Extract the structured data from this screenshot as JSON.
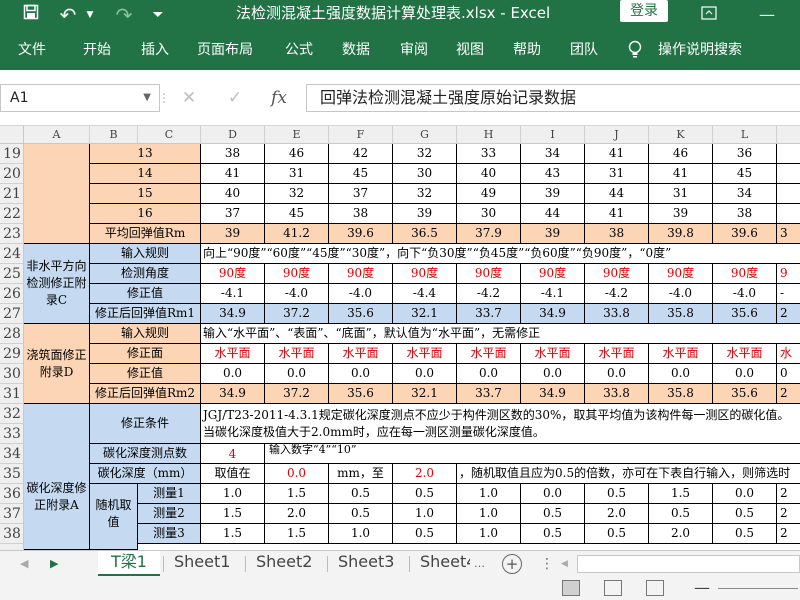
{
  "window": {
    "title": "法检测混凝土强度数据计算处理表.xlsx - Excel",
    "login_label": "登录"
  },
  "ribbon": {
    "tabs": [
      "文件",
      "开始",
      "插入",
      "页面布局",
      "公式",
      "数据",
      "审阅",
      "视图",
      "帮助",
      "团队"
    ],
    "tell_me": "操作说明搜索"
  },
  "formula_bar": {
    "cell_ref": "A1",
    "content": "回弹法检测混凝土强度原始记录数据"
  },
  "columns": [
    "A",
    "B",
    "C",
    "D",
    "E",
    "F",
    "G",
    "H",
    "I",
    "J",
    "K",
    "L"
  ],
  "rows": [
    "19",
    "20",
    "21",
    "22",
    "23",
    "24",
    "25",
    "26",
    "27",
    "28",
    "29",
    "30",
    "31",
    "32",
    "33",
    "34",
    "35",
    "36",
    "37",
    "38"
  ],
  "sheet": {
    "r19": {
      "label": "13",
      "values": [
        "38",
        "46",
        "42",
        "32",
        "33",
        "34",
        "41",
        "46",
        "36"
      ]
    },
    "r20": {
      "label": "14",
      "values": [
        "41",
        "31",
        "45",
        "30",
        "40",
        "43",
        "31",
        "41",
        "45"
      ]
    },
    "r21": {
      "label": "15",
      "values": [
        "40",
        "32",
        "37",
        "32",
        "49",
        "39",
        "44",
        "31",
        "34"
      ]
    },
    "r22": {
      "label": "16",
      "values": [
        "37",
        "45",
        "38",
        "39",
        "30",
        "44",
        "41",
        "39",
        "38"
      ]
    },
    "r23": {
      "label": "平均回弹值Rm",
      "values": [
        "39",
        "41.2",
        "39.6",
        "36.5",
        "37.9",
        "39",
        "38",
        "39.8",
        "39.6"
      ],
      "overflow": "3"
    },
    "group_c": {
      "label": "非水平方向检测修正附录C"
    },
    "r24": {
      "label": "输入规则",
      "text": "向上“90度”“60度”“45度”“30度”，向下“负30度”“负45度”“负60度”“负90度”，“0度”"
    },
    "r25": {
      "label": "检测角度",
      "values": [
        "90度",
        "90度",
        "90度",
        "90度",
        "90度",
        "90度",
        "90度",
        "90度",
        "90度"
      ],
      "overflow": "9"
    },
    "r26": {
      "label": "修正值",
      "values": [
        "-4.1",
        "-4.0",
        "-4.0",
        "-4.4",
        "-4.2",
        "-4.1",
        "-4.2",
        "-4.0",
        "-4.0"
      ],
      "overflow": "-"
    },
    "r27": {
      "label": "修正后回弹值Rm1",
      "values": [
        "34.9",
        "37.2",
        "35.6",
        "32.1",
        "33.7",
        "34.9",
        "33.8",
        "35.8",
        "35.6"
      ],
      "overflow": "2"
    },
    "group_d": {
      "label": "浇筑面修正附录D"
    },
    "r28": {
      "label": "输入规则",
      "text": "输入“水平面”、“表面”、“底面”，默认值为“水平面”，无需修正"
    },
    "r29": {
      "label": "修正面",
      "values": [
        "水平面",
        "水平面",
        "水平面",
        "水平面",
        "水平面",
        "水平面",
        "水平面",
        "水平面",
        "水平面"
      ],
      "overflow": "水"
    },
    "r30": {
      "label": "修正值",
      "values": [
        "0.0",
        "0.0",
        "0.0",
        "0.0",
        "0.0",
        "0.0",
        "0.0",
        "0.0",
        "0.0"
      ],
      "overflow": "0"
    },
    "r31": {
      "label": "修正后回弹值Rm2",
      "values": [
        "34.9",
        "37.2",
        "35.6",
        "32.1",
        "33.7",
        "34.9",
        "33.8",
        "35.8",
        "35.6"
      ],
      "overflow": "2"
    },
    "group_a": {
      "label": "碳化深度修正附录A"
    },
    "r32": {
      "label": "修正条件",
      "text": "JGJ/T23-2011-4.3.1规定碳化深度测点不应少于构件测区数的30%，取其平均值为该构件每一测区的碳化值。当碳化深度极值大于2.0mm时，应在每一测区测量碳化深度值。"
    },
    "r34": {
      "label": "碳化深度测点数",
      "value": "4",
      "note": "输入数字“4”“10”"
    },
    "r35": {
      "label": "碳化深度（mm）",
      "take": "取值在",
      "min": "0.0",
      "mm_to": "mm，至",
      "max": "2.0",
      "note": "，随机取值且应为0.5的倍数，亦可在下表自行输入，则筛选时"
    },
    "random_label": "随机取值",
    "r36": {
      "label": "测量1",
      "values": [
        "1.0",
        "1.5",
        "0.5",
        "0.5",
        "1.0",
        "0.0",
        "0.5",
        "1.5",
        "0.0"
      ],
      "overflow": "2"
    },
    "r37": {
      "label": "测量2",
      "values": [
        "1.5",
        "2.0",
        "0.5",
        "1.0",
        "1.0",
        "0.5",
        "2.0",
        "0.5",
        "0.5"
      ],
      "overflow": "2"
    },
    "r38": {
      "label": "测量3",
      "values": [
        "1.5",
        "1.5",
        "1.0",
        "0.5",
        "1.0",
        "0.5",
        "0.5",
        "2.0",
        "0.5"
      ],
      "overflow": "2"
    }
  },
  "sheet_tabs": [
    "T梁1",
    "Sheet1",
    "Sheet2",
    "Sheet3",
    "Sheet4"
  ],
  "colors": {
    "brand": "#217346",
    "orange_fill": "#fbd5b5",
    "blue_fill": "#c5d9f1",
    "red_text": "#e00000"
  }
}
